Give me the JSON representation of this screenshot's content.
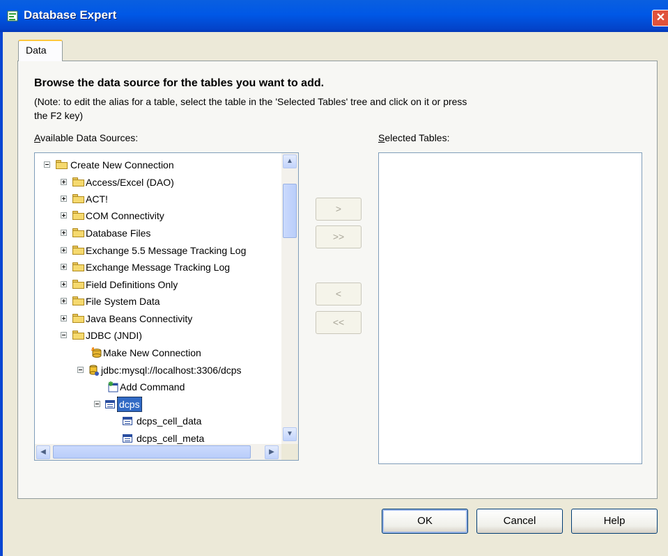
{
  "window": {
    "title": "Database Expert"
  },
  "tabs": [
    {
      "label": "Data"
    }
  ],
  "content": {
    "heading": "Browse the data source for the tables you want to add.",
    "note_line1": "(Note: to edit the alias for a table, select the table in the 'Selected Tables' tree and click on it or press",
    "note_line2": "the F2 key)",
    "available_label_accel": "A",
    "available_label_rest": "vailable Data Sources:",
    "selected_label_accel": "S",
    "selected_label_rest": "elected Tables:"
  },
  "tree": {
    "items": [
      {
        "label": "Create New Connection",
        "icon": "folder-icon"
      },
      {
        "label": "Access/Excel (DAO)",
        "icon": "folder-icon"
      },
      {
        "label": "ACT!",
        "icon": "folder-icon"
      },
      {
        "label": "COM Connectivity",
        "icon": "folder-icon"
      },
      {
        "label": "Database Files",
        "icon": "folder-icon"
      },
      {
        "label": "Exchange 5.5 Message Tracking Log",
        "icon": "folder-icon"
      },
      {
        "label": "Exchange Message Tracking Log",
        "icon": "folder-icon"
      },
      {
        "label": "Field Definitions Only",
        "icon": "folder-icon"
      },
      {
        "label": "File System Data",
        "icon": "folder-icon"
      },
      {
        "label": "Java Beans Connectivity",
        "icon": "folder-icon"
      },
      {
        "label": "JDBC (JNDI)",
        "icon": "folder-icon"
      },
      {
        "label": "Make New Connection",
        "icon": "new-connection-icon"
      },
      {
        "label": "jdbc:mysql://localhost:3306/dcps",
        "icon": "database-connection-icon"
      },
      {
        "label": "Add Command",
        "icon": "add-command-icon"
      },
      {
        "label": "dcps",
        "icon": "table-icon",
        "selected": true
      },
      {
        "label": "dcps_cell_data",
        "icon": "table-icon"
      },
      {
        "label": "dcps_cell_meta",
        "icon": "table-icon"
      }
    ]
  },
  "move_buttons": {
    "add": ">",
    "add_all": ">>",
    "remove": "<",
    "remove_all": "<<"
  },
  "buttons": {
    "ok": "OK",
    "cancel": "Cancel",
    "help": "Help"
  },
  "colors": {
    "titlebar": "#0058e6",
    "selection": "#316ac5",
    "dialog_bg": "#ece9d8"
  }
}
